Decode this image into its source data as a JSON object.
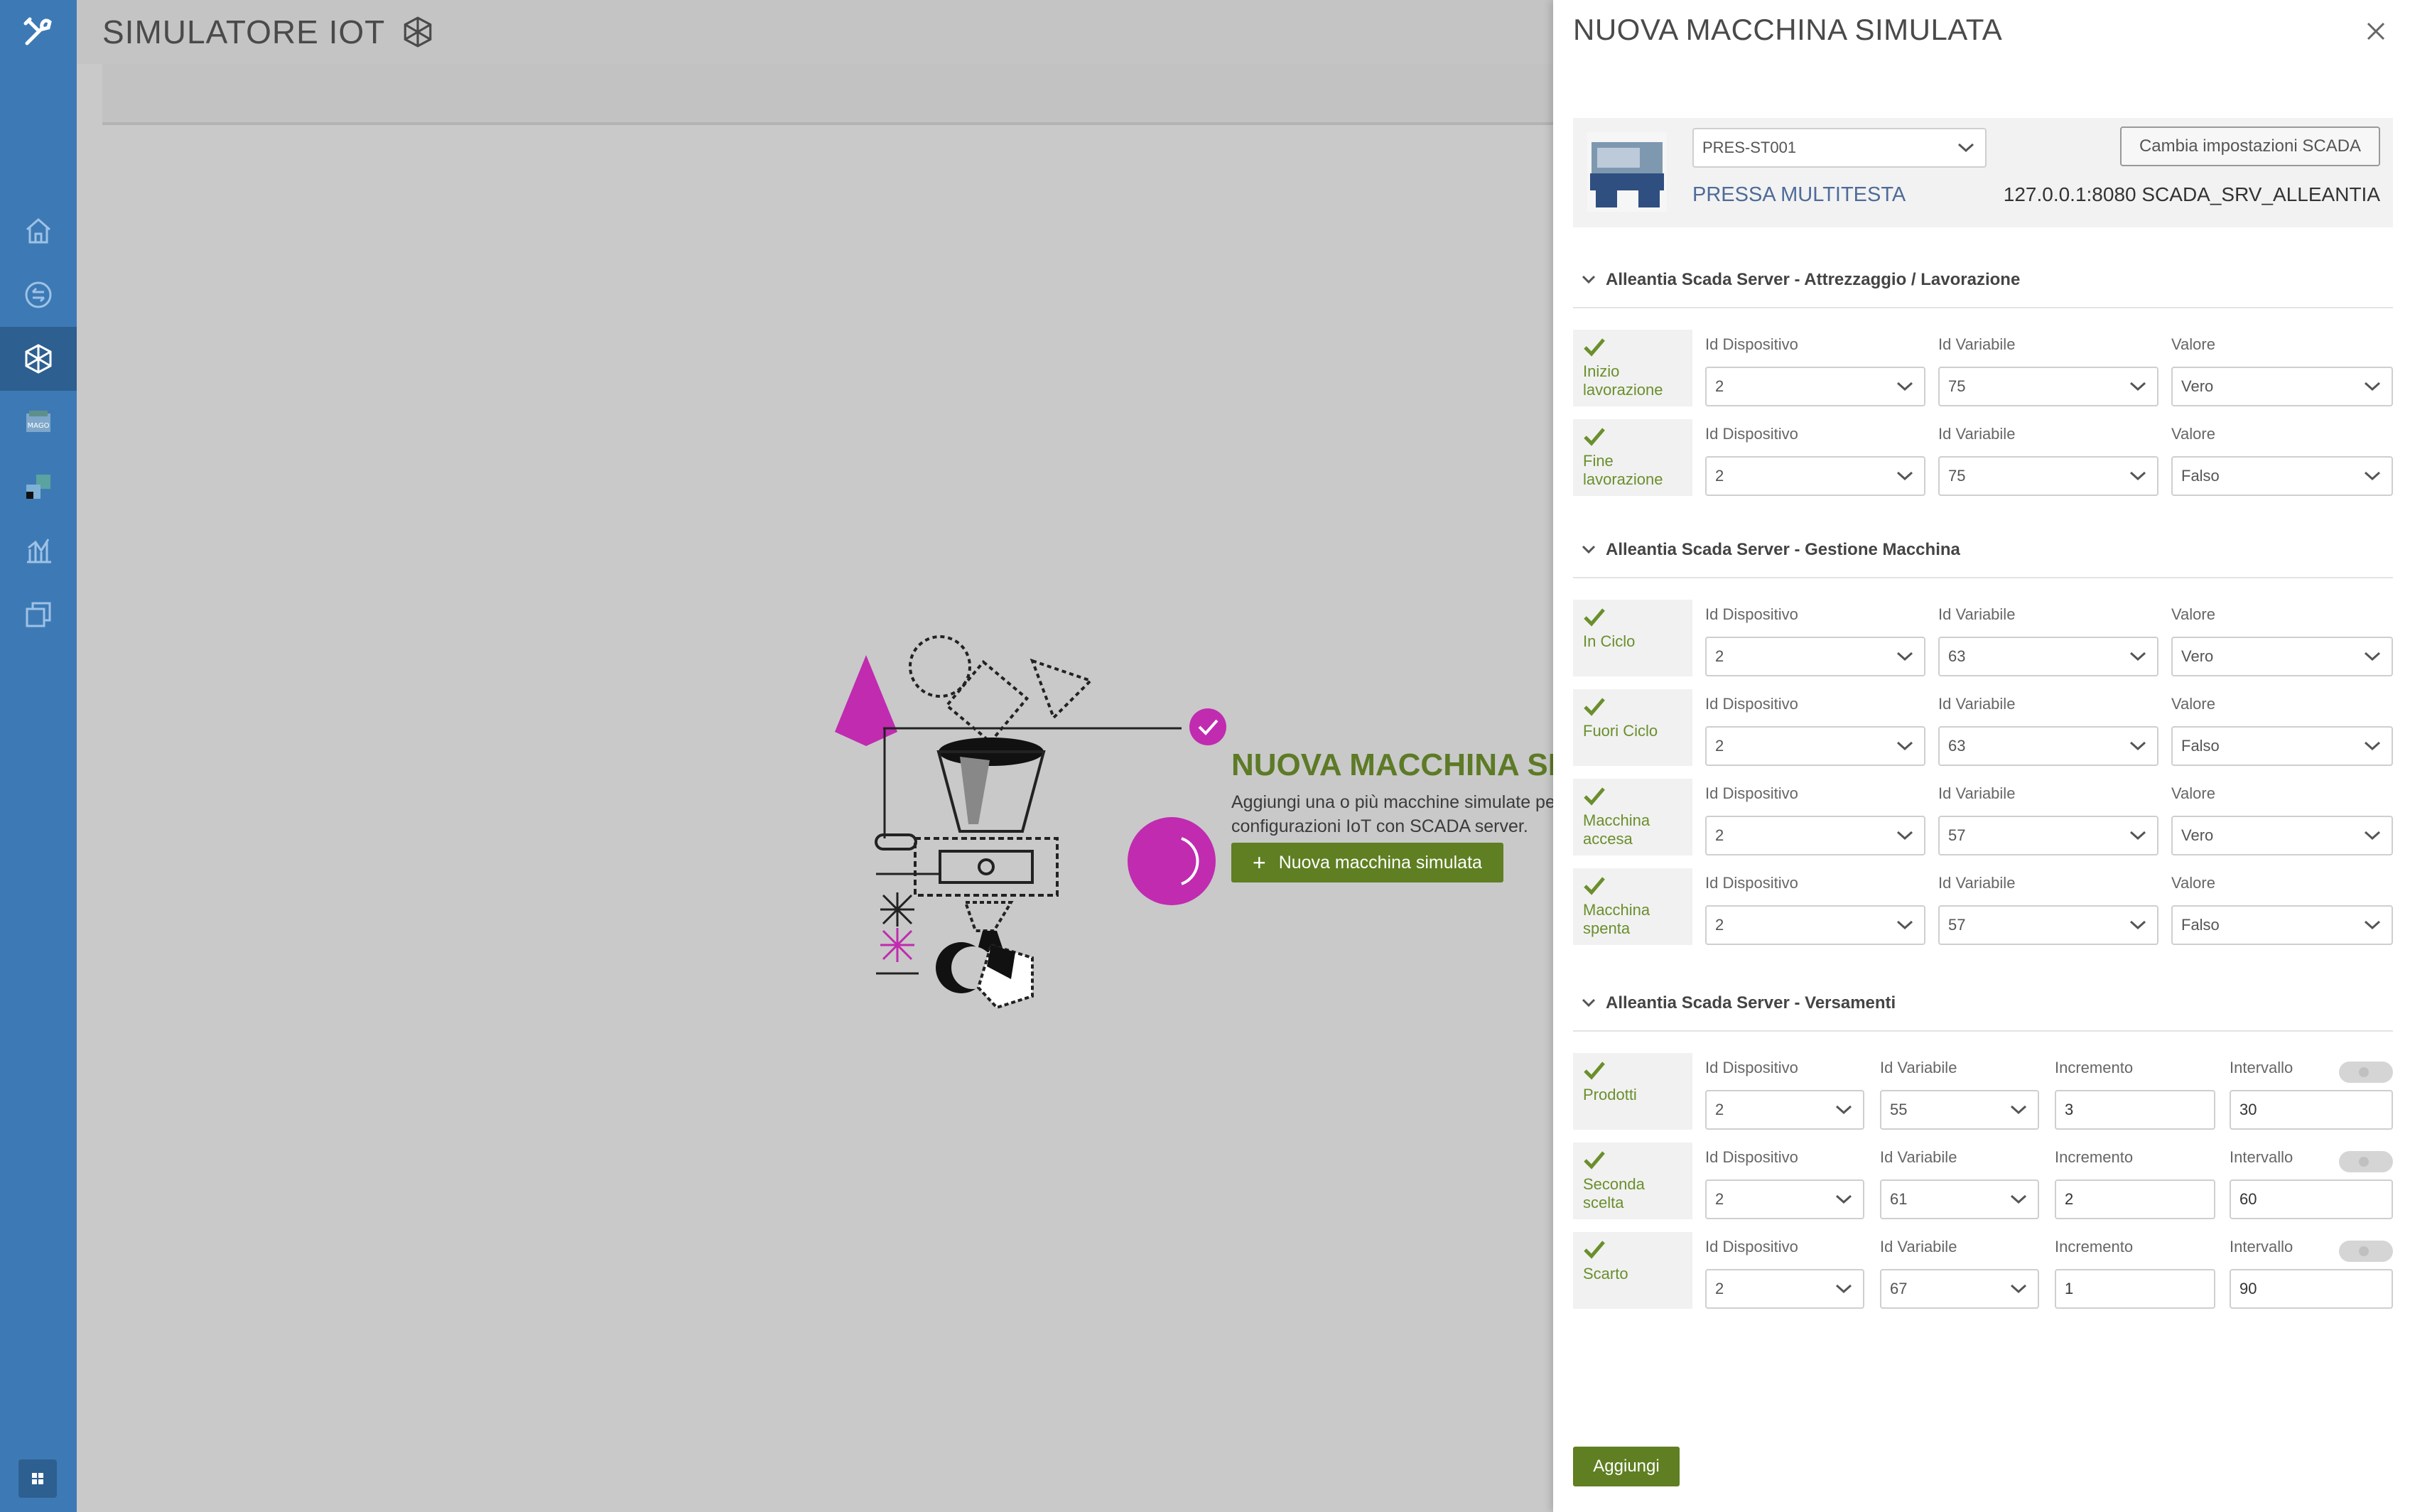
{
  "app": {
    "title": "SIMULATORE IOT"
  },
  "sidebar": {
    "items": [
      {
        "icon": "home-icon"
      },
      {
        "icon": "swap-icon"
      },
      {
        "icon": "cube-network-icon",
        "active": true
      },
      {
        "icon": "mago-icon"
      },
      {
        "icon": "grid-icon"
      },
      {
        "icon": "chart-icon"
      },
      {
        "icon": "copy-icon"
      }
    ]
  },
  "empty_state": {
    "title": "NUOVA MACCHINA SIMULATA",
    "desc_line1": "Aggiungi una o più macchine simulate per",
    "desc_line2": "configurazioni IoT con SCADA server.",
    "button": "Nuova macchina simulata",
    "accent": "#c02bb0"
  },
  "drawer": {
    "title": "NUOVA MACCHINA SIMULATA",
    "machine_code": "PRES-ST001",
    "machine_name": "PRESSA MULTITESTA",
    "scada_button": "Cambia impostazioni SCADA",
    "scada_info": "127.0.0.1:8080 SCADA_SRV_ALLEANTIA",
    "add_button": "Aggiungi",
    "accent_green": "#6a8f2c"
  },
  "captions": {
    "device": "Id Dispositivo",
    "variable": "Id Variabile",
    "value": "Valore",
    "increment": "Incremento",
    "interval": "Intervallo"
  },
  "sections": [
    {
      "title": "Alleantia Scada Server - Attrezzaggio / Lavorazione",
      "rows": [
        {
          "label": "Inizio lavorazione",
          "device": "2",
          "variable": "75",
          "value": "Vero"
        },
        {
          "label": "Fine lavorazione",
          "device": "2",
          "variable": "75",
          "value": "Falso"
        }
      ]
    },
    {
      "title": "Alleantia Scada Server - Gestione Macchina",
      "rows": [
        {
          "label": "In Ciclo",
          "device": "2",
          "variable": "63",
          "value": "Vero"
        },
        {
          "label": "Fuori Ciclo",
          "device": "2",
          "variable": "63",
          "value": "Falso"
        },
        {
          "label": "Macchina accesa",
          "device": "2",
          "variable": "57",
          "value": "Vero"
        },
        {
          "label": "Macchina spenta",
          "device": "2",
          "variable": "57",
          "value": "Falso"
        }
      ]
    },
    {
      "title": "Alleantia Scada Server - Versamenti",
      "rows": [
        {
          "label": "Prodotti",
          "device": "2",
          "variable": "55",
          "increment": "3",
          "interval": "30"
        },
        {
          "label": "Seconda scelta",
          "device": "2",
          "variable": "61",
          "increment": "2",
          "interval": "60"
        },
        {
          "label": "Scarto",
          "device": "2",
          "variable": "67",
          "increment": "1",
          "interval": "90"
        }
      ]
    }
  ]
}
